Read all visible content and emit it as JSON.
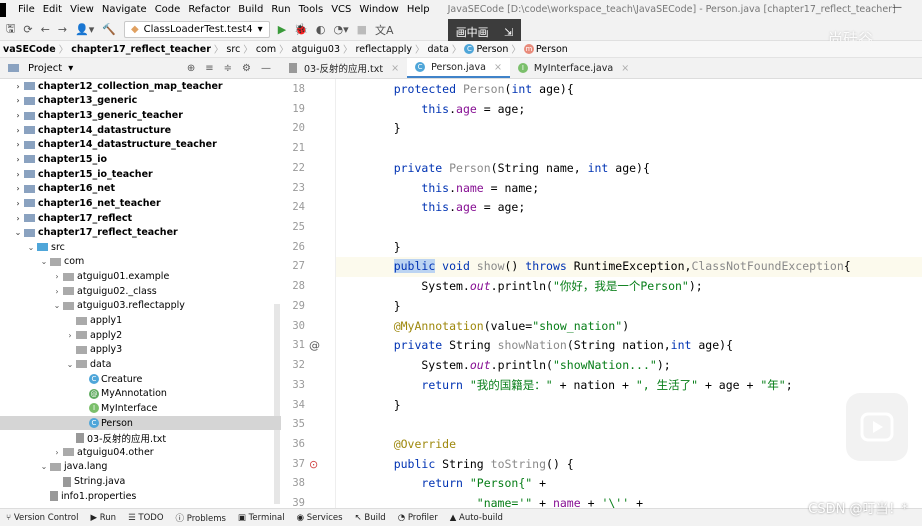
{
  "menu": [
    "File",
    "Edit",
    "View",
    "Navigate",
    "Code",
    "Refactor",
    "Build",
    "Run",
    "Tools",
    "VCS",
    "Window",
    "Help"
  ],
  "window_title": "JavaSECode [D:\\code\\workspace_teach\\JavaSECode] - Person.java [chapter17_reflect_teacher]",
  "run_config": "ClassLoaderTest.test4",
  "overlay": {
    "pip_label": "画中画",
    "watermark": "尚硅谷",
    "csdn": "CSDN @叮当！*"
  },
  "breadcrumb": [
    "vaSECode",
    "chapter17_reflect_teacher",
    "src",
    "com",
    "atguigu03",
    "reflectapply",
    "data",
    "Person",
    "Person"
  ],
  "project_label": "Project",
  "tabs": [
    {
      "label": "03-反射的应用.txt",
      "icon": "text-file-icon"
    },
    {
      "label": "Person.java",
      "icon": "class-icon",
      "active": true
    },
    {
      "label": "MyInterface.java",
      "icon": "interface-icon"
    }
  ],
  "tree": [
    {
      "label": "chapter12_collection_map_teacher",
      "level": 0,
      "arrow": ">",
      "type": "module",
      "bold": true
    },
    {
      "label": "chapter13_generic",
      "level": 0,
      "arrow": ">",
      "type": "module",
      "bold": true
    },
    {
      "label": "chapter13_generic_teacher",
      "level": 0,
      "arrow": ">",
      "type": "module",
      "bold": true
    },
    {
      "label": "chapter14_datastructure",
      "level": 0,
      "arrow": ">",
      "type": "module",
      "bold": true
    },
    {
      "label": "chapter14_datastructure_teacher",
      "level": 0,
      "arrow": ">",
      "type": "module",
      "bold": true
    },
    {
      "label": "chapter15_io",
      "level": 0,
      "arrow": ">",
      "type": "module",
      "bold": true
    },
    {
      "label": "chapter15_io_teacher",
      "level": 0,
      "arrow": ">",
      "type": "module",
      "bold": true
    },
    {
      "label": "chapter16_net",
      "level": 0,
      "arrow": ">",
      "type": "module",
      "bold": true
    },
    {
      "label": "chapter16_net_teacher",
      "level": 0,
      "arrow": ">",
      "type": "module",
      "bold": true
    },
    {
      "label": "chapter17_reflect",
      "level": 0,
      "arrow": ">",
      "type": "module",
      "bold": true
    },
    {
      "label": "chapter17_reflect_teacher",
      "level": 0,
      "arrow": "v",
      "type": "module",
      "bold": true
    },
    {
      "label": "src",
      "level": 1,
      "arrow": "v",
      "type": "src"
    },
    {
      "label": "com",
      "level": 2,
      "arrow": "v",
      "type": "pkg"
    },
    {
      "label": "atguigu01.example",
      "level": 3,
      "arrow": ">",
      "type": "pkg"
    },
    {
      "label": "atguigu02._class",
      "level": 3,
      "arrow": ">",
      "type": "pkg"
    },
    {
      "label": "atguigu03.reflectapply",
      "level": 3,
      "arrow": "v",
      "type": "pkg"
    },
    {
      "label": "apply1",
      "level": 4,
      "arrow": "",
      "type": "pkg"
    },
    {
      "label": "apply2",
      "level": 4,
      "arrow": ">",
      "type": "pkg"
    },
    {
      "label": "apply3",
      "level": 4,
      "arrow": "",
      "type": "pkg"
    },
    {
      "label": "data",
      "level": 4,
      "arrow": "v",
      "type": "pkg"
    },
    {
      "label": "Creature",
      "level": 5,
      "arrow": "",
      "type": "class"
    },
    {
      "label": "MyAnnotation",
      "level": 5,
      "arrow": "",
      "type": "annotation"
    },
    {
      "label": "MyInterface",
      "level": 5,
      "arrow": "",
      "type": "interface"
    },
    {
      "label": "Person",
      "level": 5,
      "arrow": "",
      "type": "class",
      "selected": true
    },
    {
      "label": "03-反射的应用.txt",
      "level": 4,
      "arrow": "",
      "type": "file"
    },
    {
      "label": "atguigu04.other",
      "level": 3,
      "arrow": ">",
      "type": "pkg"
    },
    {
      "label": "java.lang",
      "level": 2,
      "arrow": "v",
      "type": "pkg"
    },
    {
      "label": "String.java",
      "level": 3,
      "arrow": "",
      "type": "file"
    },
    {
      "label": "info1.properties",
      "level": 2,
      "arrow": "",
      "type": "file"
    }
  ],
  "code": [
    {
      "n": "18",
      "t": [
        [
          "    "
        ],
        [
          "protected ",
          "kw"
        ],
        [
          "Person",
          "grey"
        ],
        [
          "("
        ],
        [
          "int ",
          "kw"
        ],
        [
          "age){"
        ]
      ]
    },
    {
      "n": "19",
      "t": [
        [
          "        "
        ],
        [
          "this",
          "kw"
        ],
        [
          "."
        ],
        [
          "age",
          "fld"
        ],
        [
          " = age;"
        ]
      ]
    },
    {
      "n": "20",
      "t": [
        [
          "    }"
        ]
      ]
    },
    {
      "n": "21",
      "t": [
        [
          ""
        ]
      ]
    },
    {
      "n": "22",
      "t": [
        [
          "    "
        ],
        [
          "private ",
          "kw"
        ],
        [
          "Person",
          "grey"
        ],
        [
          "(String name, "
        ],
        [
          "int ",
          "kw"
        ],
        [
          "age){"
        ]
      ]
    },
    {
      "n": "23",
      "t": [
        [
          "        "
        ],
        [
          "this",
          "kw"
        ],
        [
          "."
        ],
        [
          "name",
          "fld"
        ],
        [
          " = name;"
        ]
      ]
    },
    {
      "n": "24",
      "t": [
        [
          "        "
        ],
        [
          "this",
          "kw"
        ],
        [
          "."
        ],
        [
          "age",
          "fld"
        ],
        [
          " = age;"
        ]
      ]
    },
    {
      "n": "25",
      "t": [
        [
          ""
        ]
      ]
    },
    {
      "n": "26",
      "t": [
        [
          "    }"
        ]
      ]
    },
    {
      "n": "27",
      "cur": true,
      "t": [
        [
          "    "
        ],
        [
          "public",
          "kw hl"
        ],
        [
          " void ",
          "kw"
        ],
        [
          "show",
          "grey"
        ],
        [
          "() "
        ],
        [
          "throws ",
          "kw"
        ],
        [
          "RuntimeException,"
        ],
        [
          "ClassNotFoundException",
          "grey"
        ],
        [
          "{"
        ]
      ]
    },
    {
      "n": "28",
      "t": [
        [
          "        System."
        ],
        [
          "out",
          "it"
        ],
        [
          ".println("
        ],
        [
          "\"你好，我是一个Person\"",
          "str"
        ],
        [
          ");"
        ]
      ]
    },
    {
      "n": "29",
      "t": [
        [
          "    }"
        ]
      ]
    },
    {
      "n": "30",
      "t": [
        [
          "    "
        ],
        [
          "@MyAnnotation",
          "ann"
        ],
        [
          "(value="
        ],
        [
          "\"show_nation\"",
          "str"
        ],
        [
          ")"
        ]
      ]
    },
    {
      "n": "31",
      "mark": "@",
      "t": [
        [
          "    "
        ],
        [
          "private ",
          "kw"
        ],
        [
          "String "
        ],
        [
          "showNation",
          "grey"
        ],
        [
          "(String nation,"
        ],
        [
          "int ",
          "kw"
        ],
        [
          "age){"
        ]
      ]
    },
    {
      "n": "32",
      "t": [
        [
          "        System."
        ],
        [
          "out",
          "it"
        ],
        [
          ".println("
        ],
        [
          "\"showNation...\"",
          "str"
        ],
        [
          ");"
        ]
      ]
    },
    {
      "n": "33",
      "t": [
        [
          "        "
        ],
        [
          "return ",
          "kw"
        ],
        [
          "\"我的国籍是：\"",
          "str"
        ],
        [
          " + nation + "
        ],
        [
          "\", 生活了\"",
          "str"
        ],
        [
          " + age + "
        ],
        [
          "\"年\"",
          "str"
        ],
        [
          ";"
        ]
      ]
    },
    {
      "n": "34",
      "t": [
        [
          "    }"
        ]
      ]
    },
    {
      "n": "35",
      "t": [
        [
          ""
        ]
      ]
    },
    {
      "n": "36",
      "t": [
        [
          "    "
        ],
        [
          "@Override",
          "ann"
        ]
      ]
    },
    {
      "n": "37",
      "mark": "o",
      "t": [
        [
          "    "
        ],
        [
          "public ",
          "kw"
        ],
        [
          "String "
        ],
        [
          "toString",
          "grey"
        ],
        [
          "() {"
        ]
      ]
    },
    {
      "n": "38",
      "t": [
        [
          "        "
        ],
        [
          "return ",
          "kw"
        ],
        [
          "\"Person{\"",
          "str"
        ],
        [
          " +"
        ]
      ]
    },
    {
      "n": "39",
      "t": [
        [
          "                "
        ],
        [
          "\"name='\"",
          "str"
        ],
        [
          " + "
        ],
        [
          "name",
          "fld"
        ],
        [
          " + "
        ],
        [
          "'\\''",
          "str"
        ],
        [
          " +"
        ]
      ]
    }
  ],
  "status_bar": [
    "Version Control",
    "Run",
    "TODO",
    "Problems",
    "Terminal",
    "Services",
    "Build",
    "Profiler",
    "Auto-build"
  ]
}
